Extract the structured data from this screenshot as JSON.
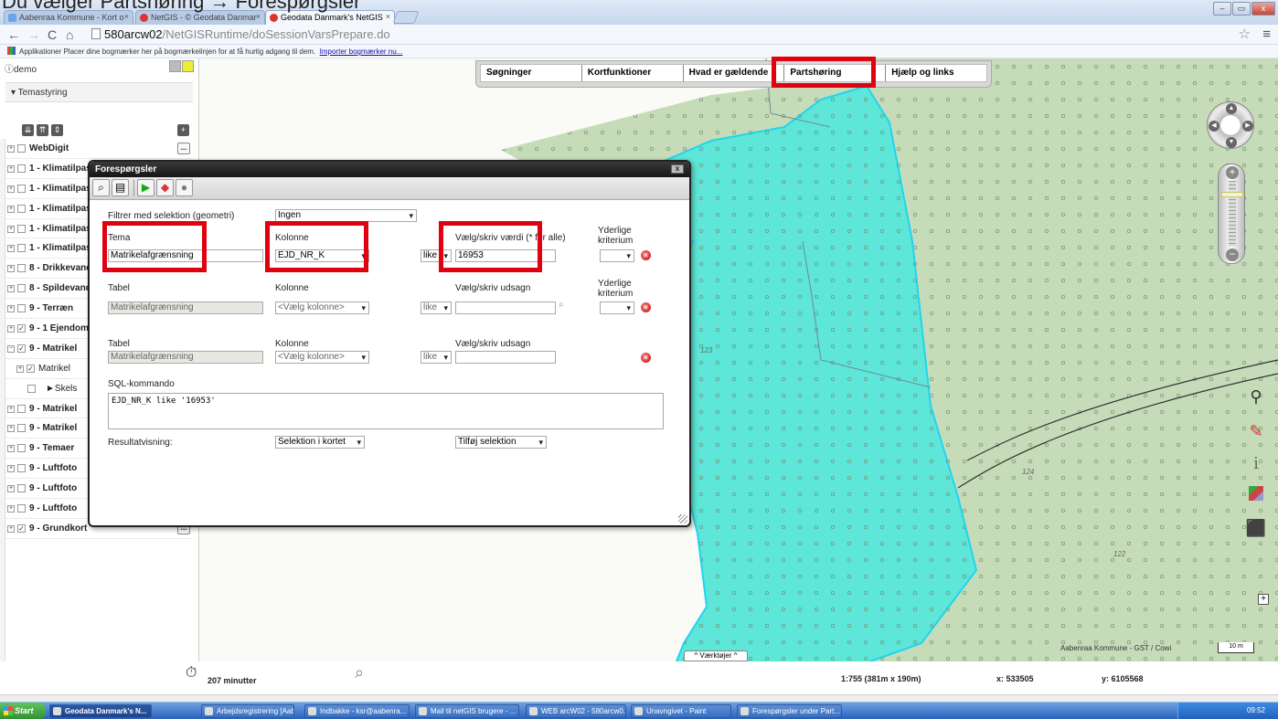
{
  "document_title": "Du vælger Partshøring → Forespørgsler",
  "browser": {
    "tabs": [
      {
        "label": "Aabenraa Kommune - Kort o"
      },
      {
        "label": "NetGIS - © Geodata Danmar"
      },
      {
        "label": "Geodata Danmark's NetGIS"
      }
    ],
    "url_host": "580arcw02",
    "url_path": "/NetGISRuntime/doSessionVarsPrepare.do",
    "bookmarks_text": "Applikationer   Placer dine bogmærker her på bogmærkelinjen for at få hurtig adgang til dem.",
    "bookmarks_link": "Importer bogmærker nu..."
  },
  "left_panel": {
    "user": "demo",
    "section_title": "Temastyring",
    "layers": [
      {
        "label": "WebDigit",
        "checked": false
      },
      {
        "label": "1 - Klimatilpasning",
        "checked": false
      },
      {
        "label": "1 - Klimatilpasning",
        "checked": false
      },
      {
        "label": "1 - Klimatilpasning",
        "checked": false
      },
      {
        "label": "1 - Klimatilpasning",
        "checked": false
      },
      {
        "label": "1 - Klimatilpasning",
        "checked": false
      },
      {
        "label": "8 - Drikkevand",
        "checked": false
      },
      {
        "label": "8 - Spildevand",
        "checked": false
      },
      {
        "label": "9 - Terræn",
        "checked": false
      },
      {
        "label": "9 - 1 Ejendom",
        "checked": true
      },
      {
        "label": "9 - Matrikel",
        "checked": true
      },
      {
        "label": "Matrikel",
        "checked": true
      },
      {
        "label": "Skels",
        "checked": false
      },
      {
        "label": "9 - Matrikel",
        "checked": false
      },
      {
        "label": "9 - Matrikel",
        "checked": false
      },
      {
        "label": "9 - Temaer",
        "checked": false
      },
      {
        "label": "9 - Luftfoto",
        "checked": false
      },
      {
        "label": "9 - Luftfoto",
        "checked": false
      },
      {
        "label": "9 - Luftfoto",
        "checked": false
      },
      {
        "label": "9 - Grundkort",
        "checked": true
      }
    ]
  },
  "map_menu": [
    "Søgninger",
    "Kortfunktioner",
    "Hvad er gældende",
    "Partshøring",
    "Hjælp og links"
  ],
  "dialog": {
    "title": "Forespørgsler",
    "filter_label": "Filtrer med selektion (geometri)",
    "filter_value": "Ingen",
    "row1": {
      "tema_label": "Tema",
      "tema_value": "Matrikelafgrænsning",
      "kolonne_label": "Kolonne",
      "kolonne_value": "EJD_NR_K",
      "op": "like",
      "value_label": "Vælg/skriv værdi (* for alle)",
      "value": "16953",
      "extra_label": "Yderlige kriterium"
    },
    "row2": {
      "tabel_label": "Tabel",
      "tabel_value": "Matrikelafgrænsning",
      "kolonne_label": "Kolonne",
      "kolonne_value": "<Vælg kolonne>",
      "op": "like",
      "value_label": "Vælg/skriv udsagn",
      "extra_label": "Yderlige kriterium"
    },
    "row3": {
      "tabel_label": "Tabel",
      "tabel_value": "Matrikelafgrænsning",
      "kolonne_label": "Kolonne",
      "kolonne_value": "<Vælg kolonne>",
      "op": "like",
      "value_label": "Vælg/skriv udsagn"
    },
    "sql_label": "SQL-kommando",
    "sql_value": "EJD_NR_K like '16953'",
    "result_label": "Resultatvisning:",
    "result_value": "Selektion i kortet",
    "add_value": "Tilføj selektion"
  },
  "map": {
    "labels": [
      "124",
      "122",
      "123"
    ],
    "vaerktojer": "^ Værktøjer ^",
    "attribution": "Aabenraa Kommune - GST / Cowi",
    "scale_label": "10 m"
  },
  "status": {
    "time": "207 minutter",
    "scale": "1:755 (381m x 190m)",
    "x": "x:  533505",
    "y": "y:  6105568"
  },
  "taskbar": {
    "start": "Start",
    "items": [
      "Geodata Danmark's N...",
      "Arbejdsregistrering [Aab...",
      "Indbakke - ksr@aabenra...",
      "Mail til netGIS brugere - ...",
      "WEB arcW02 - 580arcw0...",
      "Unavngivet - Paint",
      "Forespørgsler under Part..."
    ],
    "clock": "09:52"
  },
  "colors": {
    "accent": "#e00010",
    "polygon": "#5ee6d8",
    "green_area": "#c6dcb8"
  }
}
